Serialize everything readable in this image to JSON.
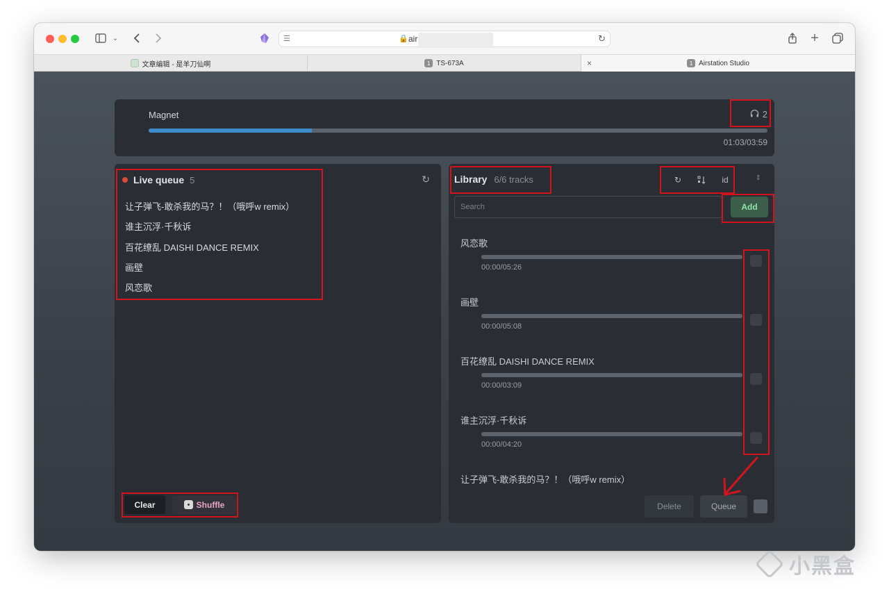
{
  "browser": {
    "url_text": "air",
    "tabs": [
      {
        "label": "文章编辑 - 是羊刀仙啊"
      },
      {
        "label": "TS-673A",
        "badge": "1"
      },
      {
        "label": "Airstation Studio",
        "badge": "1"
      }
    ],
    "tab_close_glyph": "×"
  },
  "now_playing": {
    "title": "Magnet",
    "listeners": "2",
    "progress_fraction": 0.264,
    "time": "01:03/03:59",
    "accent_color": "#3f8ccc"
  },
  "queue": {
    "title": "Live queue",
    "count": "5",
    "items": [
      "让子弹飞-敢杀我的马？！（哦呼w remix）",
      "谁主沉浮·千秋诉",
      "百花缭乱 DAISHI DANCE REMIX",
      "画壁",
      "风恋歌"
    ],
    "clear_label": "Clear",
    "shuffle_label": "Shuffle"
  },
  "library": {
    "title": "Library",
    "count": "6/6 tracks",
    "sort_id_label": "id",
    "search_placeholder": "Search",
    "add_label": "Add",
    "tracks": [
      {
        "name": "风恋歌",
        "time": "00:00/05:26"
      },
      {
        "name": "画壁",
        "time": "00:00/05:08"
      },
      {
        "name": "百花缭乱 DAISHI DANCE REMIX",
        "time": "00:00/03:09"
      },
      {
        "name": "谁主沉浮·千秋诉",
        "time": "00:00/04:20"
      },
      {
        "name": "让子弹飞-敢杀我的马？！（哦呼w remix）",
        "time": ""
      }
    ],
    "delete_label": "Delete",
    "queue_label": "Queue"
  },
  "watermark": {
    "text": "小黑盒"
  },
  "colors": {
    "annotation": "#d4141c",
    "add_button": "#3d5e4b",
    "shuffle_text": "#e8a7c8"
  }
}
